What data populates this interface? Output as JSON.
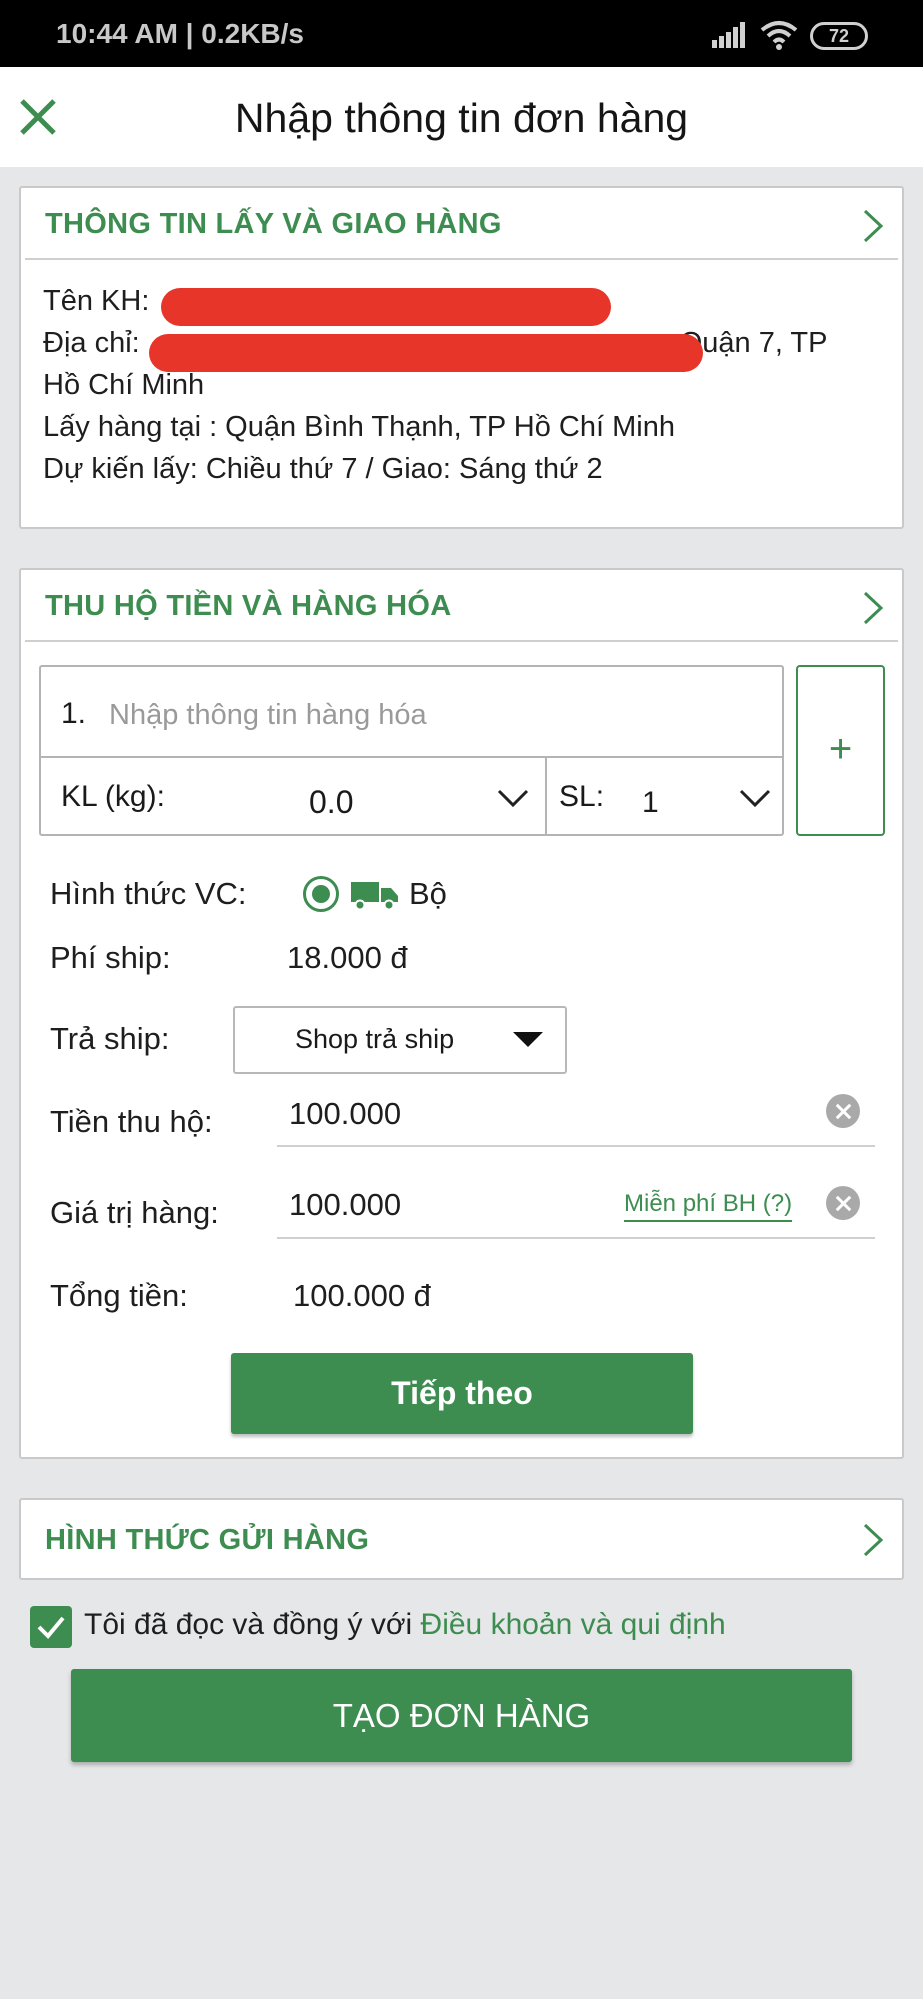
{
  "status_bar": {
    "time": "10:44 AM | 0.2KB/s",
    "battery": "72"
  },
  "app_bar": {
    "title": "Nhập thông tin đơn hàng",
    "close_icon": "close-icon"
  },
  "pickup_delivery": {
    "header": "THÔNG TIN LẤY VÀ GIAO HÀNG",
    "customer_label": "Tên KH:",
    "address_label": "Địa chỉ:",
    "address_tail": "Quận 7, TP",
    "address_line2": "Hồ Chí Minh",
    "pickup_at": "Lấy hàng tại : Quận Bình Thạnh, TP Hồ Chí Minh",
    "expected": "Dự kiến lấy: Chiều thứ 7 / Giao: Sáng thứ 2"
  },
  "cod_goods": {
    "header": "THU HỘ TIỀN VÀ HÀNG HÓA",
    "item_number": "1.",
    "item_placeholder": "Nhập thông tin hàng hóa",
    "weight_label": "KL (kg):",
    "weight_value": "0.0",
    "qty_label": "SL:",
    "qty_value": "1",
    "add_label": "+",
    "transport_label": "Hình thức VC:",
    "transport_value": "Bộ",
    "ship_fee_label": "Phí ship:",
    "ship_fee_value": "18.000 đ",
    "ship_payer_label": "Trả ship:",
    "ship_payer_value": "Shop trả ship",
    "cod_label": "Tiền thu hộ:",
    "cod_value": "100.000",
    "goods_value_label": "Giá trị hàng:",
    "goods_value": "100.000",
    "insurance_link": "Miễn phí BH (?)",
    "total_label": "Tổng tiền:",
    "total_value": "100.000 đ",
    "next_button": "Tiếp theo"
  },
  "send_method": {
    "header": "HÌNH THỨC GỬI HÀNG"
  },
  "agreement": {
    "text": "Tôi đã đọc và đồng ý với ",
    "link": "Điều khoản và qui định",
    "checked": true
  },
  "create_button": "TẠO ĐƠN HÀNG",
  "colors": {
    "accent": "#3d8c50",
    "redaction": "#e8352a",
    "background": "#e6e7e9"
  }
}
